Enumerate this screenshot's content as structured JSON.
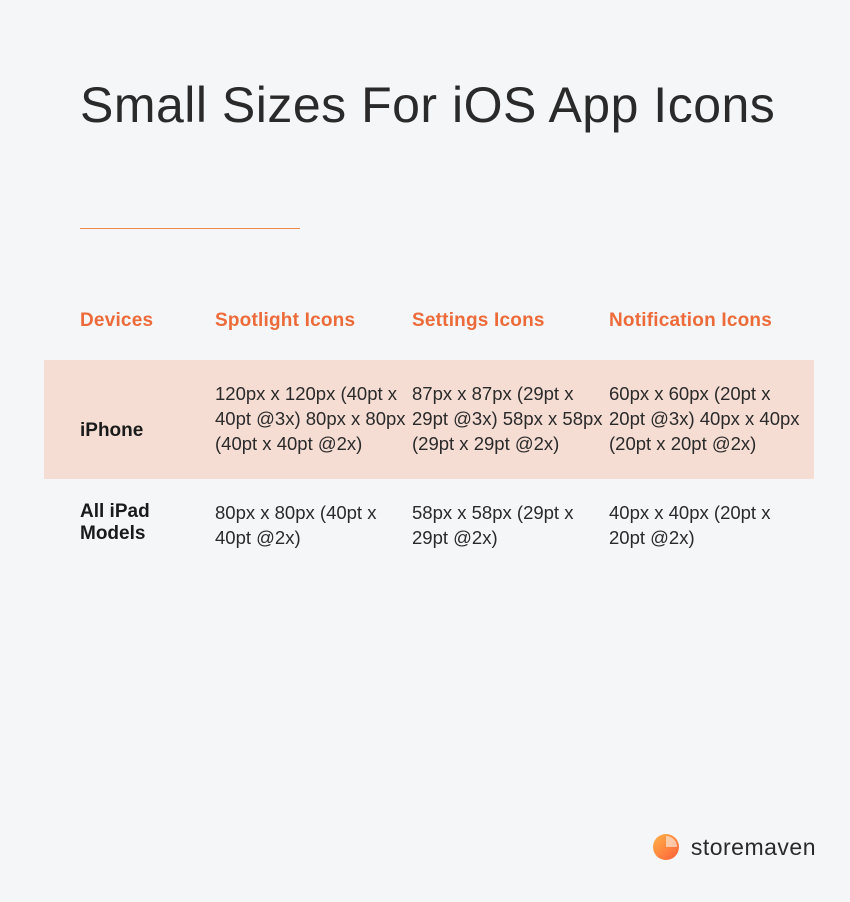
{
  "title": "Small Sizes For iOS App Icons",
  "headers": {
    "devices": "Devices",
    "spotlight": "Spotlight Icons",
    "settings": "Settings Icons",
    "notification": "Notification Icons"
  },
  "rows": [
    {
      "device": "iPhone",
      "spotlight": "120px x 120px (40pt x 40pt @3x) 80px x 80px (40pt x 40pt @2x)",
      "settings": "87px x 87px (29pt x 29pt @3x) 58px x 58px (29pt x 29pt @2x)",
      "notification": "60px x 60px (20pt x 20pt @3x) 40px x 40px (20pt x 20pt @2x)"
    },
    {
      "device": "All iPad Models",
      "spotlight": "80px x 80px (40pt x 40pt @2x)",
      "settings": "58px x 58px (29pt x 29pt @2x)",
      "notification": "40px x 40px (20pt x 20pt @2x)"
    }
  ],
  "logo": {
    "name": "storemaven"
  },
  "chart_data": {
    "type": "table",
    "title": "Small Sizes For iOS App Icons",
    "columns": [
      "Devices",
      "Spotlight Icons",
      "Settings Icons",
      "Notification Icons"
    ],
    "rows": [
      {
        "Devices": "iPhone",
        "Spotlight Icons": [
          {
            "px": "120px x 120px",
            "pt": "40pt x 40pt",
            "scale": "@3x"
          },
          {
            "px": "80px x 80px",
            "pt": "40pt x 40pt",
            "scale": "@2x"
          }
        ],
        "Settings Icons": [
          {
            "px": "87px x 87px",
            "pt": "29pt x 29pt",
            "scale": "@3x"
          },
          {
            "px": "58px x 58px",
            "pt": "29pt x 29pt",
            "scale": "@2x"
          }
        ],
        "Notification Icons": [
          {
            "px": "60px x 60px",
            "pt": "20pt x 20pt",
            "scale": "@3x"
          },
          {
            "px": "40px x 40px",
            "pt": "20pt x 20pt",
            "scale": "@2x"
          }
        ]
      },
      {
        "Devices": "All iPad Models",
        "Spotlight Icons": [
          {
            "px": "80px x 80px",
            "pt": "40pt x 40pt",
            "scale": "@2x"
          }
        ],
        "Settings Icons": [
          {
            "px": "58px x 58px",
            "pt": "29pt x 29pt",
            "scale": "@2x"
          }
        ],
        "Notification Icons": [
          {
            "px": "40px x 40px",
            "pt": "20pt x 20pt",
            "scale": "@2x"
          }
        ]
      }
    ]
  }
}
